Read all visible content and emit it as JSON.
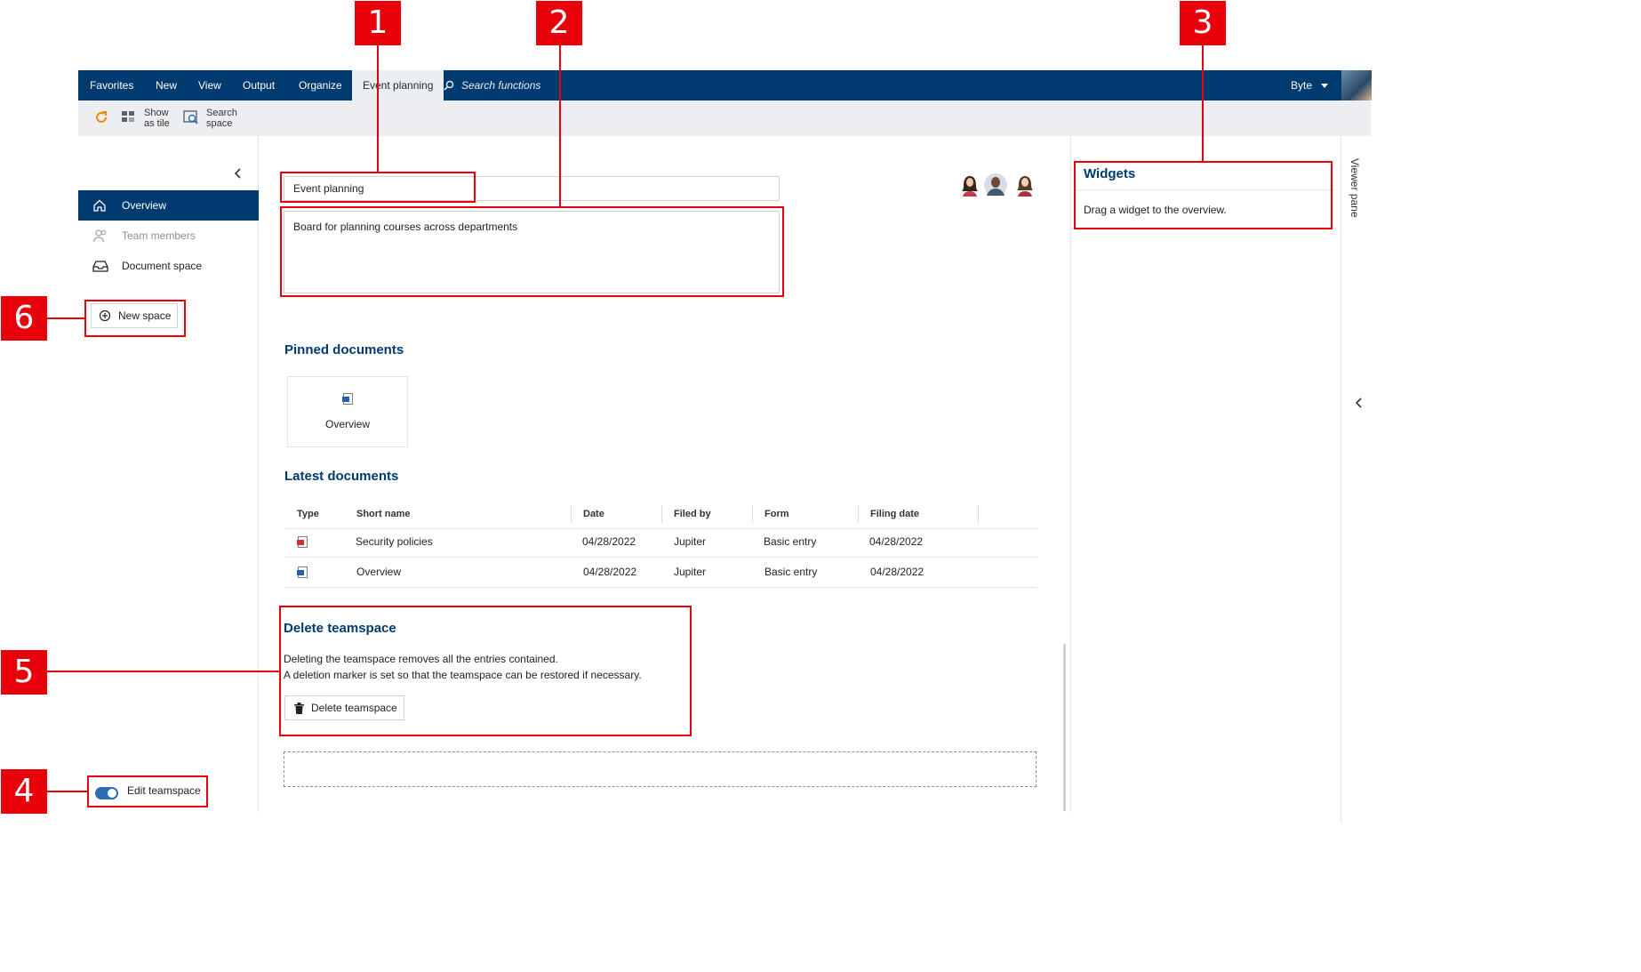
{
  "callouts": [
    "1",
    "2",
    "3",
    "4",
    "5",
    "6"
  ],
  "menu": {
    "items": [
      "Favorites",
      "New",
      "View",
      "Output",
      "Organize",
      "Event planning"
    ],
    "search_placeholder": "Search functions",
    "user": "Byte"
  },
  "toolbar": {
    "show_tile": [
      "Show",
      "as tile"
    ],
    "search_space": [
      "Search",
      "space"
    ]
  },
  "sidebar": {
    "items": [
      {
        "label": "Overview",
        "icon": "home-icon"
      },
      {
        "label": "Team members",
        "icon": "people-icon"
      },
      {
        "label": "Document space",
        "icon": "inbox-icon"
      }
    ],
    "new_space": "New space",
    "edit_teamspace": "Edit teamspace"
  },
  "main": {
    "title_value": "Event planning",
    "description_value": "Board for planning courses across departments",
    "pinned_title": "Pinned documents",
    "pinned_doc": "Overview",
    "latest_title": "Latest documents",
    "columns": [
      "Type",
      "Short name",
      "Date",
      "Filed by",
      "Form",
      "Filing date"
    ],
    "rows": [
      {
        "type": "pdf",
        "name": "Security policies",
        "date": "04/28/2022",
        "filed_by": "Jupiter",
        "form": "Basic entry",
        "filing_date": "04/28/2022"
      },
      {
        "type": "word",
        "name": "Overview",
        "date": "04/28/2022",
        "filed_by": "Jupiter",
        "form": "Basic entry",
        "filing_date": "04/28/2022"
      }
    ],
    "delete_title": "Delete teamspace",
    "delete_text_1": "Deleting the teamspace removes all the entries contained.",
    "delete_text_2": "A deletion marker is set so that the teamspace can be restored if necessary.",
    "delete_button": "Delete teamspace"
  },
  "widgets": {
    "title": "Widgets",
    "hint": "Drag a widget to the overview."
  },
  "viewer_pane": "Viewer pane",
  "colors": {
    "brand": "#003a70",
    "callout": "#e8000b",
    "refresh": "#f08a00"
  }
}
